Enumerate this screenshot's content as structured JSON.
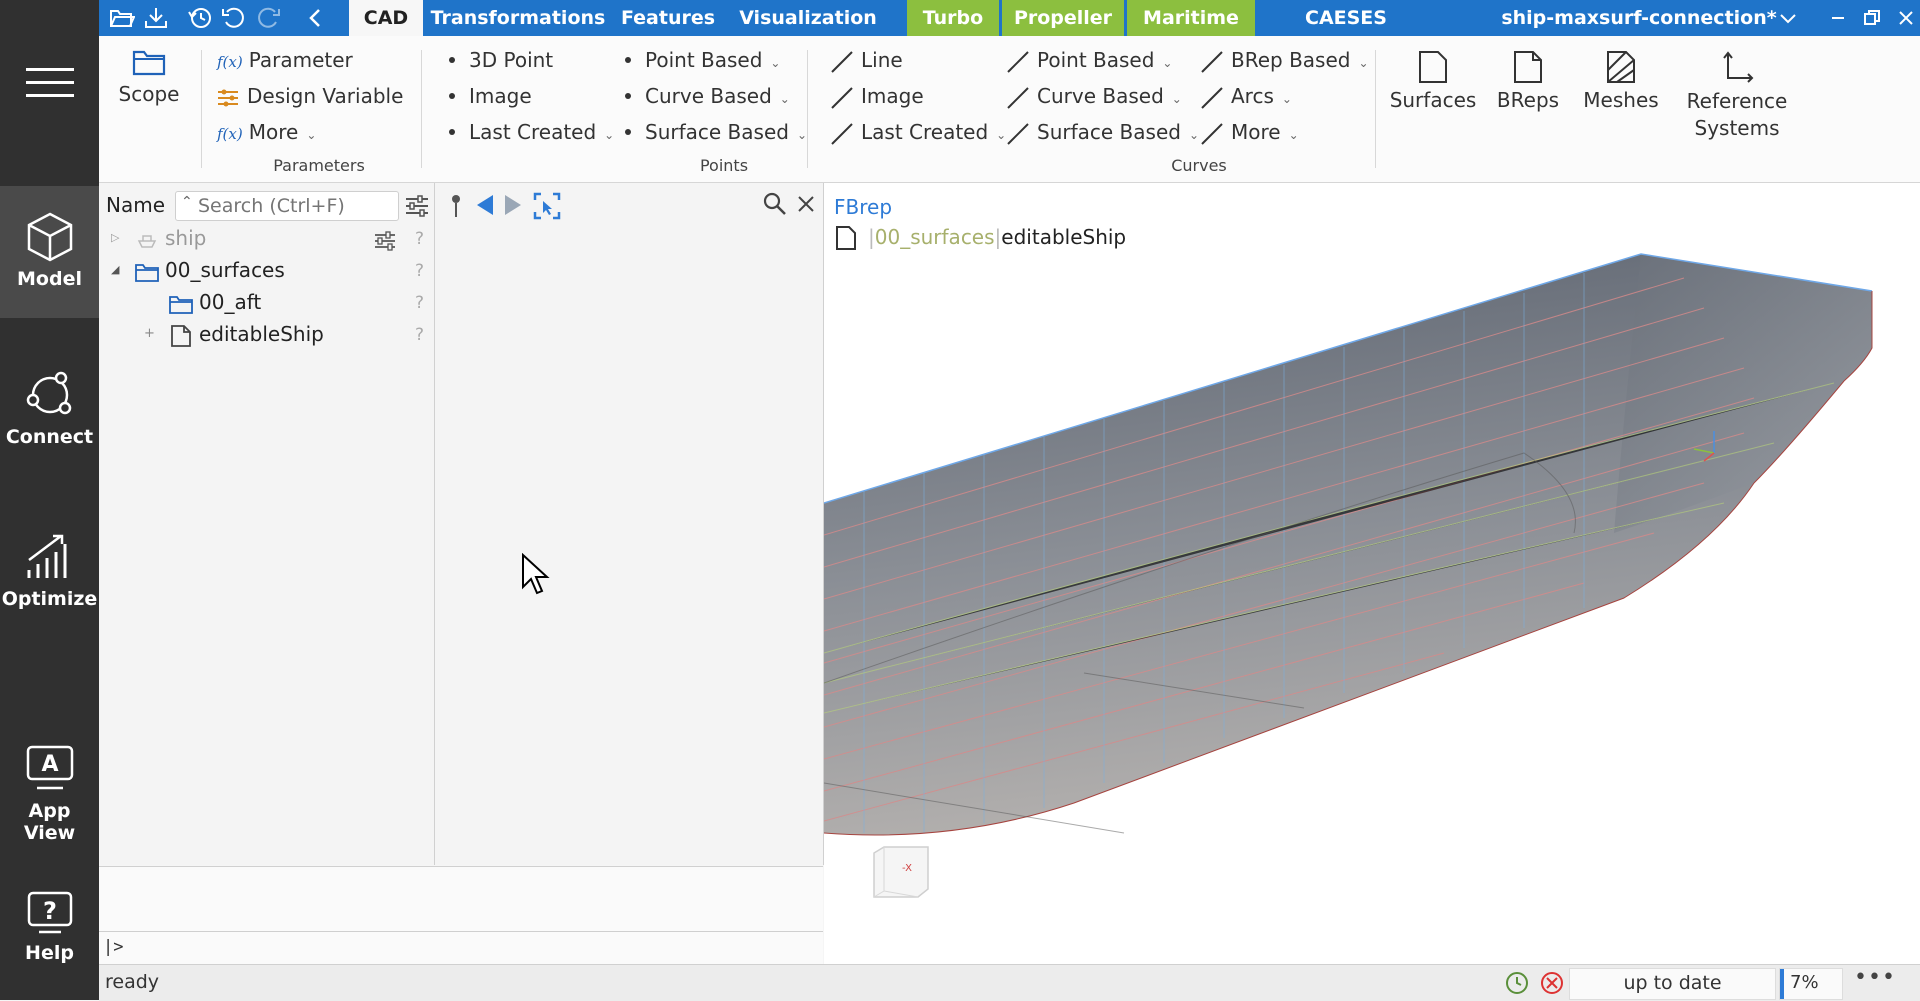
{
  "rail": {
    "items": [
      {
        "label": "",
        "icon": "hamburger-menu-icon"
      },
      {
        "label": "Model",
        "icon": "cube-icon"
      },
      {
        "label": "Connect",
        "icon": "connect-icon"
      },
      {
        "label": "Optimize",
        "icon": "optimize-chart-icon"
      },
      {
        "label": "App View",
        "icon": "app-view-icon"
      },
      {
        "label": "Help",
        "icon": "help-icon"
      }
    ]
  },
  "topbar": {
    "tabs": [
      "CAD",
      "Transformations",
      "Features",
      "Visualization",
      "Turbo",
      "Propeller",
      "Maritime",
      "CAESES"
    ],
    "active_tab": "CAD",
    "project_title": "ship-maxsurf-connection*",
    "colors": {
      "bar": "#1f74c9",
      "green_tab": "#8cbf3f"
    }
  },
  "ribbon": {
    "scope_label": "Scope",
    "parameters": {
      "items": [
        "Parameter",
        "Design Variable",
        "More"
      ],
      "group_label": "Parameters"
    },
    "points": {
      "col1": [
        "3D Point",
        "Image",
        "Last Created"
      ],
      "col2": [
        "Point Based",
        "Curve Based",
        "Surface Based"
      ],
      "group_label": "Points"
    },
    "curves": {
      "col1": [
        "Line",
        "Image",
        "Last Created"
      ],
      "col2": [
        "Point Based",
        "Curve Based",
        "Surface Based"
      ],
      "col3": [
        "BRep Based",
        "Arcs",
        "More"
      ],
      "group_label": "Curves"
    },
    "big_buttons": [
      "Surfaces",
      "BReps",
      "Meshes",
      "Reference Systems"
    ]
  },
  "tree": {
    "header_label": "Name",
    "search_placeholder": "Search (Ctrl+F)",
    "rows": [
      {
        "label": "ship",
        "help": "?"
      },
      {
        "label": "00_surfaces",
        "help": "?"
      },
      {
        "label": "00_aft",
        "help": "?"
      },
      {
        "label": "editableShip",
        "help": "?"
      }
    ]
  },
  "viewport": {
    "type_label": "FBrep",
    "breadcrumb_parent": "00_surfaces",
    "breadcrumb_current": "editableShip",
    "nav_cube_label": "-X"
  },
  "console": {
    "prompt": "|>"
  },
  "status": {
    "text": "ready",
    "update_state": "up to date",
    "progress": "7%"
  }
}
